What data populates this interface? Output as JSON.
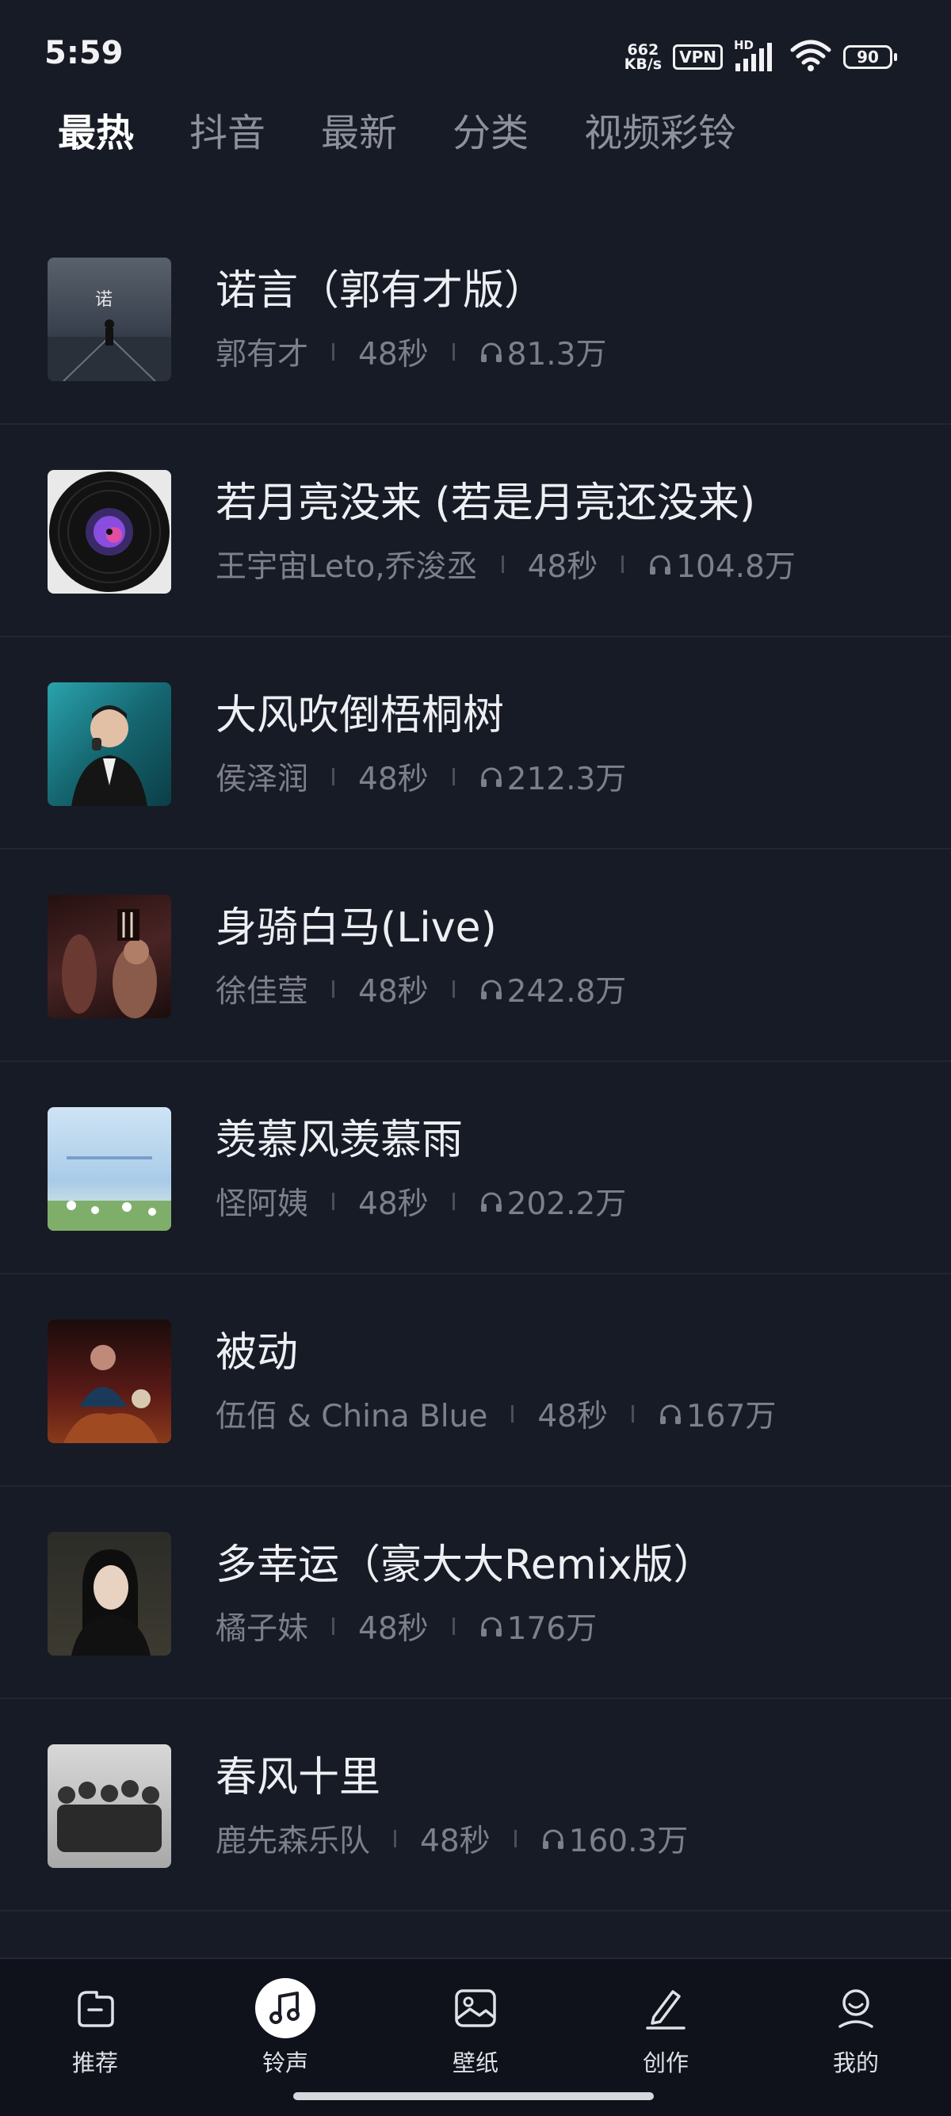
{
  "status_bar": {
    "time": "5:59",
    "net_speed_value": "662",
    "net_speed_unit": "KB/s",
    "vpn": "VPN",
    "hd": "HD",
    "battery": "90"
  },
  "tabs": [
    {
      "label": "最热",
      "active": true
    },
    {
      "label": "抖音",
      "active": false
    },
    {
      "label": "最新",
      "active": false
    },
    {
      "label": "分类",
      "active": false
    },
    {
      "label": "视频彩铃",
      "active": false
    }
  ],
  "songs": [
    {
      "title": "诺言（郭有才版）",
      "artist": "郭有才",
      "duration": "48秒",
      "plays": "81.3万",
      "cover_bg": "#4a5462"
    },
    {
      "title": "若月亮没来 (若是月亮还没来)",
      "artist": "王宇宙Leto,乔浚丞",
      "duration": "48秒",
      "plays": "104.8万",
      "cover_bg": "#e8e8e8"
    },
    {
      "title": "大风吹倒梧桐树",
      "artist": "侯泽润",
      "duration": "48秒",
      "plays": "212.3万",
      "cover_bg": "#1f7c8a"
    },
    {
      "title": "身骑白马(Live)",
      "artist": "徐佳莹",
      "duration": "48秒",
      "plays": "242.8万",
      "cover_bg": "#3a2020"
    },
    {
      "title": "羡慕风羡慕雨",
      "artist": "怪阿姨",
      "duration": "48秒",
      "plays": "202.2万",
      "cover_bg": "#bcd8ee"
    },
    {
      "title": "被动",
      "artist": "伍佰 & China Blue",
      "duration": "48秒",
      "plays": "167万",
      "cover_bg": "#4a1818"
    },
    {
      "title": "多幸运（豪大大Remix版）",
      "artist": "橘子妹",
      "duration": "48秒",
      "plays": "176万",
      "cover_bg": "#2e2e2a"
    },
    {
      "title": "春风十里",
      "artist": "鹿先森乐队",
      "duration": "48秒",
      "plays": "160.3万",
      "cover_bg": "#b8b8b8"
    }
  ],
  "nav": [
    {
      "label": "推荐",
      "icon": "recommend-icon",
      "active": false
    },
    {
      "label": "铃声",
      "icon": "music-note-icon",
      "active": true
    },
    {
      "label": "壁纸",
      "icon": "wallpaper-icon",
      "active": false
    },
    {
      "label": "创作",
      "icon": "pen-icon",
      "active": false
    },
    {
      "label": "我的",
      "icon": "profile-icon",
      "active": false
    }
  ]
}
